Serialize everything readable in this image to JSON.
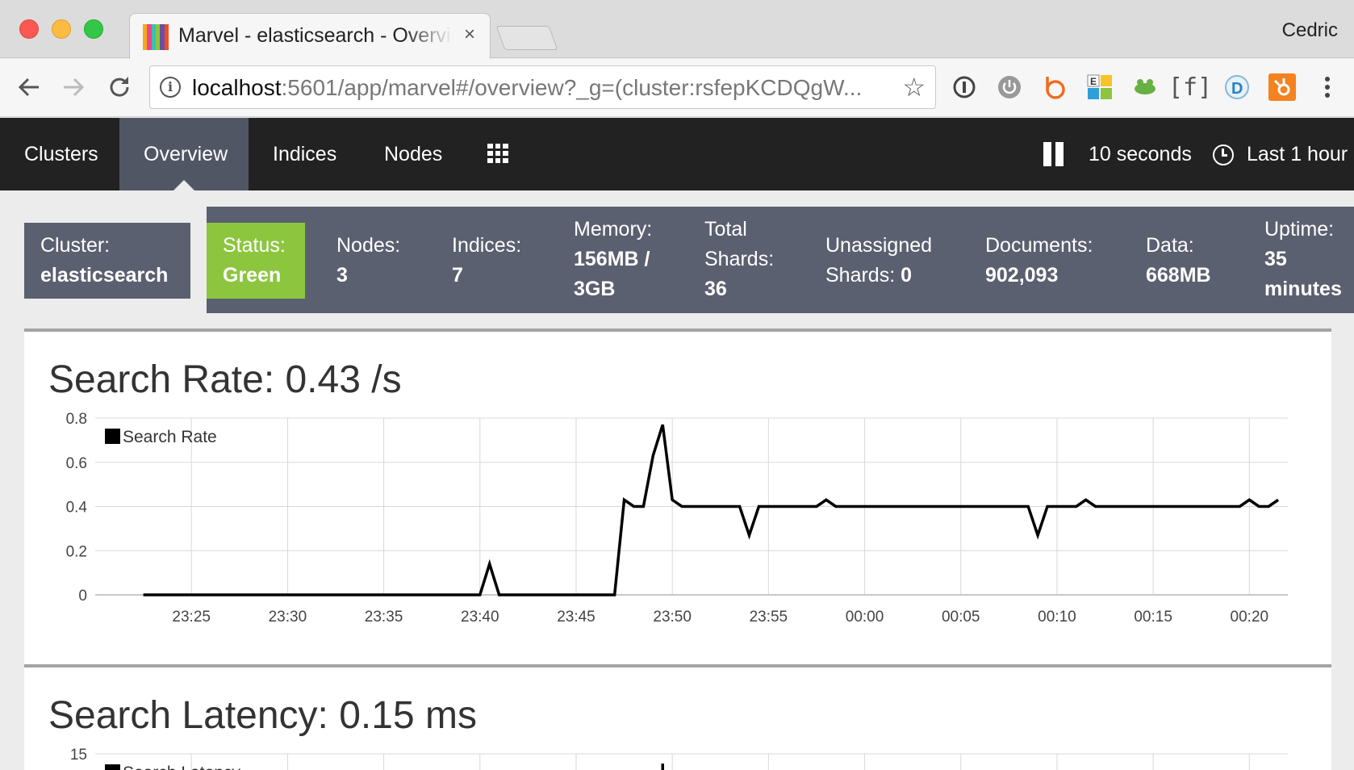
{
  "browser": {
    "tab_title": "Marvel - elasticsearch - Overview",
    "tab_close": "×",
    "profile_name": "Cedric",
    "url_host": "localhost",
    "url_rest": ":5601/app/marvel#/overview?_g=(cluster:rsfepKCDQgW...",
    "star_glyph": "☆",
    "extensions": [
      "1password-icon",
      "power-icon",
      "b-icon",
      "e-icon",
      "frog-icon",
      "f-bracket-icon",
      "d-icon",
      "hubspot-icon",
      "more-icon"
    ],
    "extension_f_label": "[f]",
    "extension_d_label": "D"
  },
  "nav": {
    "items": [
      {
        "label": "Clusters"
      },
      {
        "label": "Overview",
        "active": true
      },
      {
        "label": "Indices"
      },
      {
        "label": "Nodes"
      }
    ],
    "refresh_interval": "10 seconds",
    "time_range": "Last 1 hour"
  },
  "cluster": {
    "label": "Cluster:",
    "name": "elasticsearch"
  },
  "status": {
    "label": "Status:",
    "value": "Green",
    "color": "#8cc63f"
  },
  "stats": {
    "nodes_label": "Nodes:",
    "nodes_value": "3",
    "indices_label": "Indices:",
    "indices_value": "7",
    "memory_label": "Memory:",
    "memory_value_1": "156MB /",
    "memory_value_2": "3GB",
    "total_shards_label_1": "Total",
    "total_shards_label_2": "Shards:",
    "total_shards_value": "36",
    "unassigned_label": "Unassigned",
    "unassigned_label_2": "Shards:",
    "unassigned_value": "0",
    "documents_label": "Documents:",
    "documents_value": "902,093",
    "data_label": "Data:",
    "data_value": "668MB",
    "uptime_label": "Uptime:",
    "uptime_value_1": "35",
    "uptime_value_2": "minutes"
  },
  "panels": {
    "search_rate_title": "Search Rate: 0.43 /s",
    "search_latency_title": "Search Latency: 0.15 ms"
  },
  "chart_data": [
    {
      "type": "line",
      "title": "Search Rate: 0.43 /s",
      "legend": [
        "Search Rate"
      ],
      "legend_position": "top-left",
      "grid": true,
      "ylim": [
        0,
        0.8
      ],
      "yticks": [
        "0",
        "0.2",
        "0.4",
        "0.6",
        "0.8"
      ],
      "xticks": [
        "23:25",
        "23:30",
        "23:35",
        "23:40",
        "23:45",
        "23:50",
        "23:55",
        "00:00",
        "00:05",
        "00:10",
        "00:15",
        "00:20"
      ],
      "series": [
        {
          "name": "Search Rate",
          "color": "#000000",
          "x": [
            "23:22:30",
            "23:40:00",
            "23:40:30",
            "23:41:00",
            "23:47:00",
            "23:47:30",
            "23:48:00",
            "23:48:30",
            "23:49:00",
            "23:49:30",
            "23:50:00",
            "23:50:30",
            "23:53:30",
            "23:54:00",
            "23:54:30",
            "23:57:30",
            "23:58:00",
            "23:58:30",
            "00:08:30",
            "00:09:00",
            "00:09:30",
            "00:11:00",
            "00:11:30",
            "00:12:00",
            "00:19:30",
            "00:20:00",
            "00:20:30",
            "00:21:00",
            "00:21:30"
          ],
          "y": [
            0,
            0,
            0.14,
            0,
            0,
            0.43,
            0.4,
            0.4,
            0.63,
            0.77,
            0.43,
            0.4,
            0.4,
            0.27,
            0.4,
            0.4,
            0.43,
            0.4,
            0.4,
            0.27,
            0.4,
            0.4,
            0.43,
            0.4,
            0.4,
            0.43,
            0.4,
            0.4,
            0.43
          ]
        }
      ]
    },
    {
      "type": "line",
      "title": "Search Latency: 0.15 ms",
      "legend": [
        "Search Latency"
      ],
      "legend_position": "top-left",
      "grid": true,
      "yticks": [
        "15"
      ]
    }
  ]
}
